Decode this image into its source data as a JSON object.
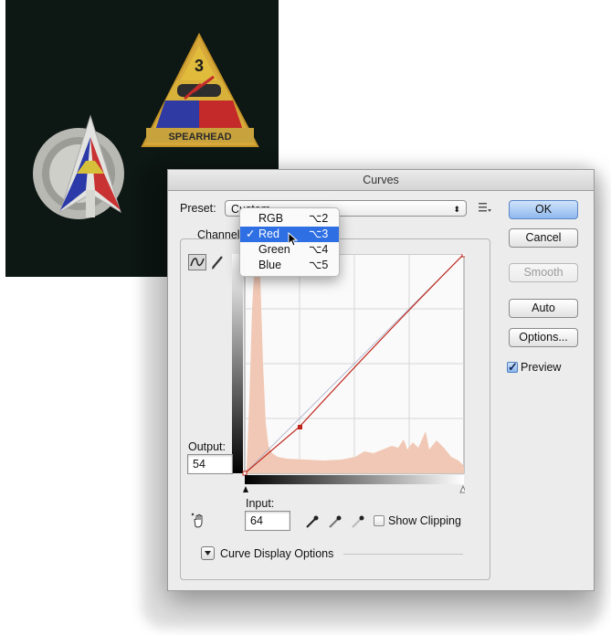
{
  "photo": {
    "badge_number": "3",
    "badge_motto": "SPEARHEAD"
  },
  "dialog": {
    "title": "Curves",
    "preset_label": "Preset:",
    "preset_value": "Custom",
    "channel_label": "Channel",
    "output_label": "Output:",
    "output_value": "54",
    "input_label": "Input:",
    "input_value": "64",
    "show_clipping_label": "Show Clipping",
    "curve_display_options_label": "Curve Display Options",
    "preview_label": "Preview",
    "preview_checked": true,
    "show_clipping_checked": false
  },
  "buttons": {
    "ok": "OK",
    "cancel": "Cancel",
    "smooth": "Smooth",
    "auto": "Auto",
    "options": "Options..."
  },
  "channel_menu": {
    "items": [
      {
        "label": "RGB",
        "shortcut": "⌥2",
        "checked": false,
        "highlighted": false
      },
      {
        "label": "Red",
        "shortcut": "⌥3",
        "checked": true,
        "highlighted": true
      },
      {
        "label": "Green",
        "shortcut": "⌥4",
        "checked": false,
        "highlighted": false
      },
      {
        "label": "Blue",
        "shortcut": "⌥5",
        "checked": false,
        "highlighted": false
      }
    ],
    "check_glyph": "✓"
  },
  "curve": {
    "control_points": [
      [
        0,
        0
      ],
      [
        64,
        54
      ],
      [
        255,
        255
      ]
    ]
  },
  "colors": {
    "histogram": "#f1c8b5",
    "curve": "#c0251b",
    "ok_button": "#8fb9ee",
    "menu_highlight": "#2f6fe4"
  },
  "icons": [
    "curve-tool-icon",
    "pencil-icon",
    "hand-adjust-icon",
    "eyedropper-black-icon",
    "eyedropper-gray-icon",
    "eyedropper-white-icon",
    "preset-options-icon",
    "disclosure-icon"
  ]
}
